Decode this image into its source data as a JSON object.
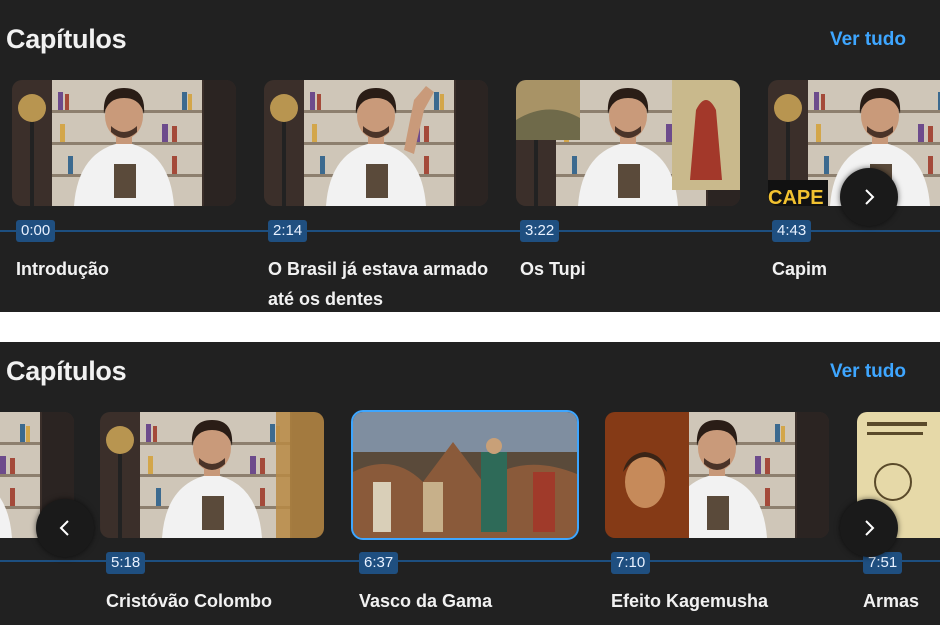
{
  "panel_top": {
    "title": "Capítulos",
    "see_all": "Ver tudo",
    "chapters": [
      {
        "time": "0:00",
        "title": "Introdução"
      },
      {
        "time": "2:14",
        "title": "O Brasil já estava armado até os dentes"
      },
      {
        "time": "3:22",
        "title": "Os Tupi"
      },
      {
        "time": "4:43",
        "title": "Capim",
        "thumb_text": "CAPE"
      }
    ]
  },
  "panel_bottom": {
    "title": "Capítulos",
    "see_all": "Ver tudo",
    "chapters": [
      {
        "time": "5:18",
        "title": "Cristóvão Colombo"
      },
      {
        "time": "6:37",
        "title": "Vasco da Gama",
        "selected": true
      },
      {
        "time": "7:10",
        "title": "Efeito Kagemusha"
      },
      {
        "time": "7:51",
        "title": "Armas"
      }
    ]
  },
  "icons": {
    "prev": "chevron-left-icon",
    "next": "chevron-right-icon"
  },
  "colors": {
    "background": "#212121",
    "accent": "#3ea6ff",
    "timeline": "#1d4f80",
    "text": "#f1f1f1"
  }
}
